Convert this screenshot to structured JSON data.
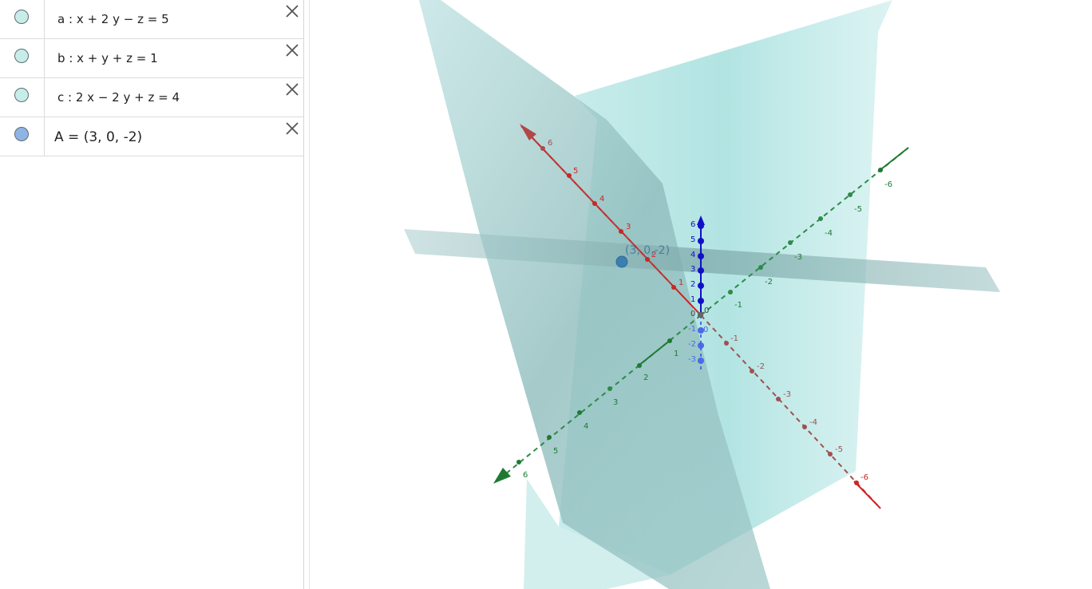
{
  "algebra": {
    "items": [
      {
        "label": "a",
        "sep": ":",
        "expr": "x + 2 y − z = 5",
        "marble_color": "#c8ede9"
      },
      {
        "label": "b",
        "sep": ":",
        "expr": "x + y + z = 1",
        "marble_color": "#c8ede9"
      },
      {
        "label": "c",
        "sep": ":",
        "expr": "2 x − 2 y + z = 4",
        "marble_color": "#c8ede9"
      },
      {
        "label": "A",
        "sep": "=",
        "expr": "(3, 0, -2)",
        "marble_color": "#8fb4e3"
      }
    ],
    "delete_icon": "close-icon"
  },
  "view3d": {
    "point_label": "(3, 0,-2)",
    "colors": {
      "x_axis": "#d32020",
      "y_axis": "#1e7a32",
      "z_axis": "#1010c8",
      "plane": "#b6e6e4",
      "plane_dark": "#7fa9aa",
      "point": "#3a7fb0"
    },
    "x_ticks_pos": [
      "6",
      "5",
      "4",
      "3",
      "2",
      "1"
    ],
    "x_ticks_neg": [
      "-1",
      "-2",
      "-3",
      "-4",
      "-5",
      "-6"
    ],
    "y_ticks_pos": [
      "1",
      "2",
      "3",
      "4",
      "5",
      "6"
    ],
    "y_ticks_neg": [
      "-1",
      "-2",
      "-3",
      "-4",
      "-5",
      "-6"
    ],
    "z_ticks_pos": [
      "6",
      "5",
      "4",
      "3",
      "2",
      "1",
      "0"
    ],
    "z_ticks_neg": [
      "-1",
      "-2",
      "-3"
    ],
    "origin_labels": [
      "0",
      "0"
    ]
  }
}
